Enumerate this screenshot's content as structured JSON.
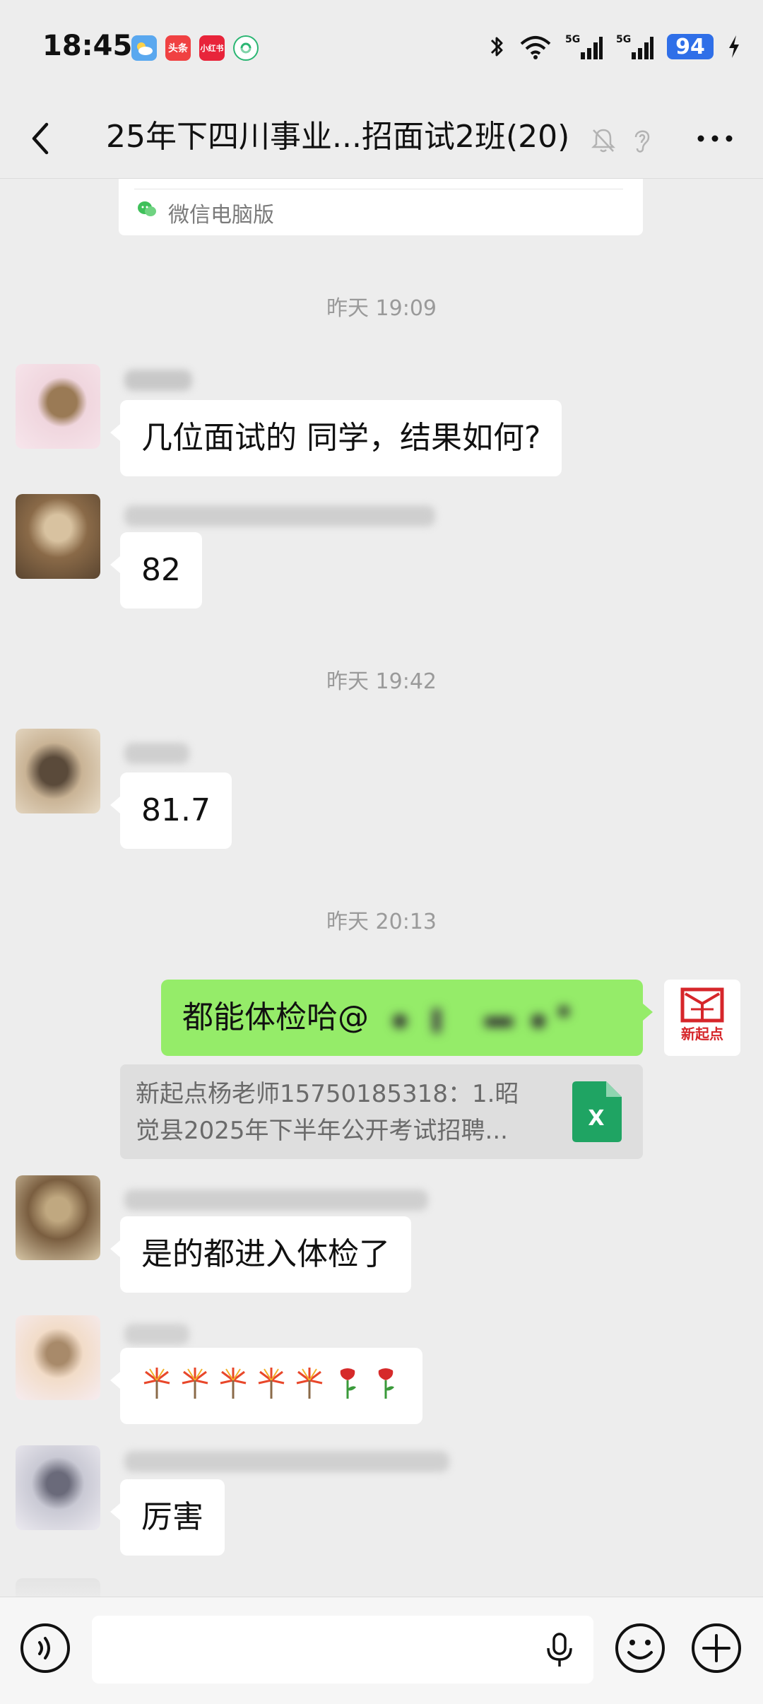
{
  "status_bar": {
    "time": "18:45",
    "app_badges": [
      "weather",
      "头条",
      "小红书",
      "green-app"
    ],
    "toutiao_label": "头条",
    "redbook_label": "小红书",
    "battery": "94"
  },
  "nav": {
    "title": "25年下四川事业...招面试2班(20)",
    "icons": [
      "back-icon",
      "mute-bell-icon",
      "ear-icon",
      "more-icon"
    ]
  },
  "card_tail": {
    "source": "微信电脑版"
  },
  "messages": {
    "t1": "昨天 19:09",
    "m1": "几位面试的 同学，结果如何?",
    "m2": "82",
    "t2": "昨天 19:42",
    "m3": "81.7",
    "t3": "昨天 20:13",
    "mine": "都能体检哈@",
    "quote": {
      "line1": "新起点杨老师15750185318：1.昭",
      "line2": "觉县2025年下半年公开考试招聘..."
    },
    "excel_label": "X",
    "m5": "是的都进入体检了",
    "m6_emoji": [
      "firework",
      "firework",
      "firework",
      "firework",
      "firework",
      "rose",
      "rose"
    ],
    "m7": "厉害"
  },
  "my_avatar": {
    "label": "新起点"
  },
  "input_bar": {
    "placeholder": ""
  },
  "colors": {
    "background": "#ededed",
    "my_bubble": "#95ec69",
    "their_bubble": "#ffffff",
    "brand_red": "#d6262a",
    "excel_green": "#1fa463",
    "battery_blue": "#2f6fe8"
  }
}
